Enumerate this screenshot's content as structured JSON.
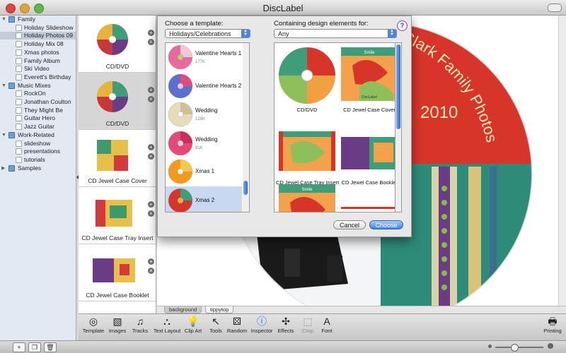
{
  "window": {
    "title": "DiscLabel"
  },
  "sidebar": {
    "groups": [
      {
        "label": "Family",
        "children": [
          "Holiday Slideshow",
          "Holiday Photos 09",
          "Holiday Mix 08",
          "Xmas photos",
          "Family Album",
          "Ski Video",
          "Everett's Birthday"
        ]
      },
      {
        "label": "Music Mixes",
        "children": [
          "RockOn",
          "Jonathan Coulton",
          "They Might Be",
          "Guitar Hero",
          "Jazz Guitar"
        ]
      },
      {
        "label": "Work-Related",
        "children": [
          "slideshow",
          "presentations",
          "tutorials"
        ]
      },
      {
        "label": "Samples",
        "children": []
      }
    ],
    "selected": "Holiday Photos 09"
  },
  "thumbnails": {
    "items": [
      {
        "caption": "CD/DVD"
      },
      {
        "caption": "CD/DVD"
      },
      {
        "caption": "CD Jewel Case Cover"
      },
      {
        "caption": "CD Jewel Case Tray Insert"
      },
      {
        "caption": "CD Jewel Case Booklet"
      }
    ],
    "selected_index": 1
  },
  "canvas": {
    "label_lines": [
      "Clark Family Photos",
      "2010"
    ],
    "layers": [
      "background",
      "tippytop"
    ],
    "active_layer": "background"
  },
  "sheet": {
    "template_label": "Choose a template:",
    "template_popup": "Holidays/Celebrations",
    "elements_label": "Containing design elements for:",
    "elements_popup": "Any",
    "help": "?",
    "templates": [
      {
        "name": "Valentine Hearts 1",
        "size": "177K"
      },
      {
        "name": "Valentine Hearts 2",
        "size": ""
      },
      {
        "name": "Wedding",
        "size": "128K"
      },
      {
        "name": "Wedding",
        "size": "81K"
      },
      {
        "name": "Xmas 1",
        "size": ""
      },
      {
        "name": "Xmas 2",
        "size": ""
      }
    ],
    "selected_template": "Xmas 2",
    "elements": [
      {
        "caption": "CD/DVD"
      },
      {
        "caption": "CD Jewel Case Cover"
      },
      {
        "caption": "CD Jewel Case Tray Insert"
      },
      {
        "caption": "CD Jewel Case Booklet"
      }
    ],
    "element_banner": "Smile",
    "element_footer": "DiscLabel",
    "cancel": "Cancel",
    "choose": "Choose"
  },
  "toolbar": {
    "tools": [
      "Template",
      "Images",
      "Tracks",
      "Text Layout",
      "Clip Art",
      "Tools",
      "Random",
      "Inspector",
      "Effects",
      "Crop",
      "Font"
    ],
    "disabled": [
      "Crop"
    ],
    "printing": "Printing"
  },
  "colors": {
    "accent": "#3d84e6",
    "label_red": "#d8352a",
    "label_teal": "#2e8b78",
    "selection": "#c7d8ef"
  }
}
